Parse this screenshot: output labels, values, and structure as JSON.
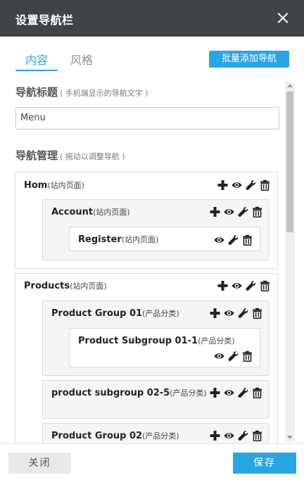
{
  "dialog": {
    "title": "设置导航栏"
  },
  "tabs": [
    {
      "label": "内容",
      "active": true
    },
    {
      "label": "风格",
      "active": false
    }
  ],
  "batch_add_label": "批量添加导航",
  "nav_title_section": {
    "title": "导航标题",
    "hint": "( 手机端显示的导航文字 )"
  },
  "menu_input": {
    "value": "Menu"
  },
  "nav_manage_section": {
    "title": "导航管理",
    "hint": "( 拖动以调整导航 )"
  },
  "nav_items": {
    "hom": {
      "name": "Hom",
      "type": "(站内页面)"
    },
    "account": {
      "name": "Account",
      "type": "(站内页面)"
    },
    "register": {
      "name": "Register",
      "type": "(站内页面)"
    },
    "products": {
      "name": "Products",
      "type": "(站内页面)"
    },
    "pg01": {
      "name": "Product Group 01",
      "type": "(产品分类)"
    },
    "psg011": {
      "name": "Product Subgroup 01-1",
      "type": "(产品分类)"
    },
    "psg025": {
      "name": "product subgroup 02-5",
      "type": "(产品分类)"
    },
    "pg02": {
      "name": "Product Group 02",
      "type": "(产品分类)"
    }
  },
  "footer": {
    "close_label": "关闭",
    "save_label": "保存"
  },
  "colors": {
    "header_bg": "#3f4448",
    "accent": "#2aa5e3"
  },
  "icons": [
    "close-icon",
    "add-icon",
    "eye-icon",
    "wrench-icon",
    "trash-icon"
  ]
}
